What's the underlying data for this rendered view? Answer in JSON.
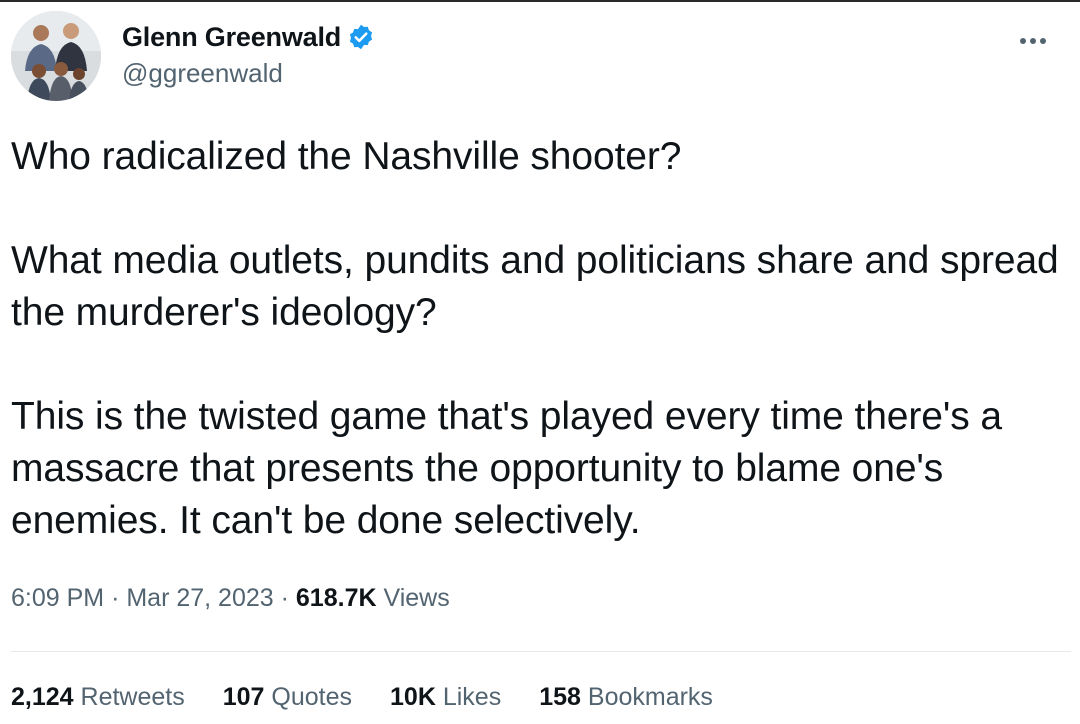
{
  "author": {
    "display_name": "Glenn Greenwald",
    "handle": "@ggreenwald",
    "verified": true,
    "verified_color": "#1d9bf0"
  },
  "tweet": {
    "paragraphs": [
      "Who radicalized the Nashville shooter?",
      "What media outlets, pundits and politicians share and spread the murderer's ideology?",
      "This is the twisted game that's played every time there's a massacre that presents the opportunity to blame one's enemies. It can't be done selectively."
    ]
  },
  "meta": {
    "time": "6:09 PM",
    "separator": "·",
    "date": "Mar 27, 2023",
    "views_count": "618.7K",
    "views_label": "Views"
  },
  "stats": {
    "retweets": {
      "count": "2,124",
      "label": "Retweets"
    },
    "quotes": {
      "count": "107",
      "label": "Quotes"
    },
    "likes": {
      "count": "10K",
      "label": "Likes"
    },
    "bookmarks": {
      "count": "158",
      "label": "Bookmarks"
    }
  },
  "icons": {
    "verified": "verified-badge-icon",
    "more": "more-options-icon"
  }
}
